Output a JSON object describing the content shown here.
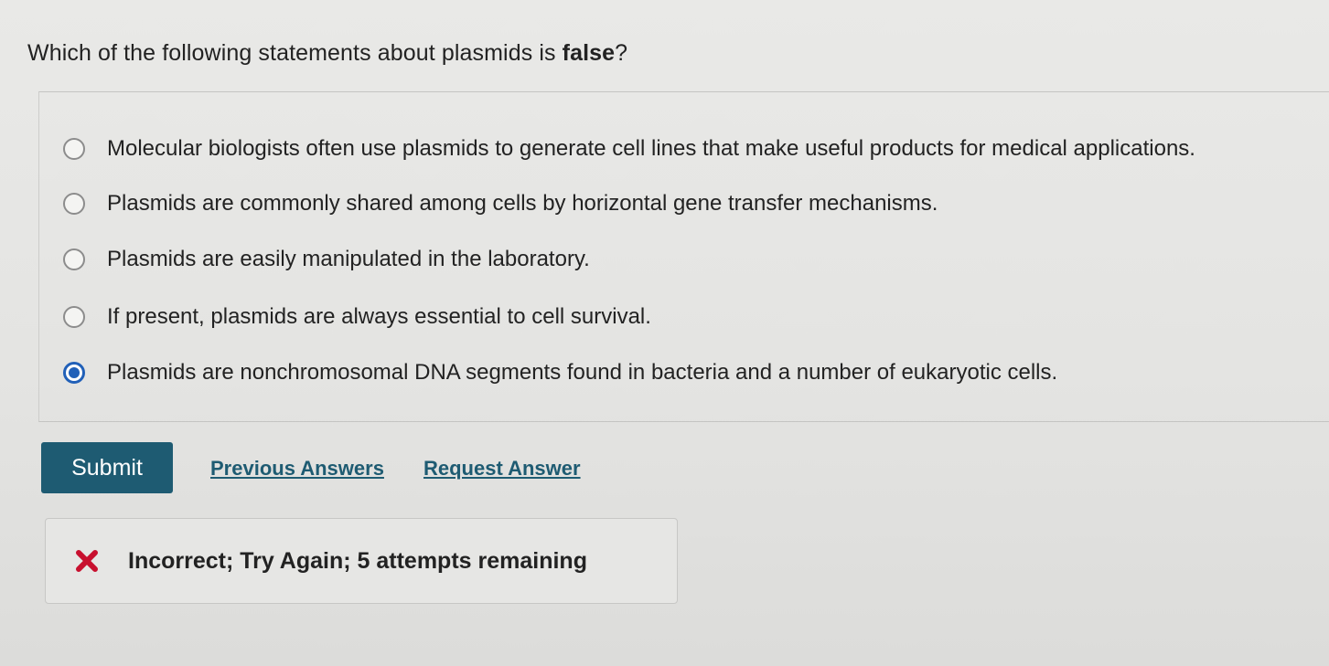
{
  "question": {
    "prefix": "Which of the following statements about plasmids is ",
    "emphasis": "false",
    "suffix": "?"
  },
  "options": [
    {
      "label": "Molecular biologists often use plasmids to generate cell lines that make useful products for medical applications.",
      "selected": false
    },
    {
      "label": "Plasmids are commonly shared among cells by horizontal gene transfer mechanisms.",
      "selected": false
    },
    {
      "label": "Plasmids are easily manipulated in the laboratory.",
      "selected": false
    },
    {
      "label": "If present, plasmids are always essential to cell survival.",
      "selected": false
    },
    {
      "label": "Plasmids are nonchromosomal DNA segments found in bacteria and a number of eukaryotic cells.",
      "selected": true
    }
  ],
  "actions": {
    "submit_label": "Submit",
    "previous_answers_label": "Previous Answers",
    "request_answer_label": "Request Answer"
  },
  "feedback": {
    "icon": "x-icon",
    "message": "Incorrect; Try Again; 5 attempts remaining"
  },
  "colors": {
    "accent": "#1e5b72",
    "radio_selected": "#2160b8",
    "error_red": "#c8102e"
  }
}
